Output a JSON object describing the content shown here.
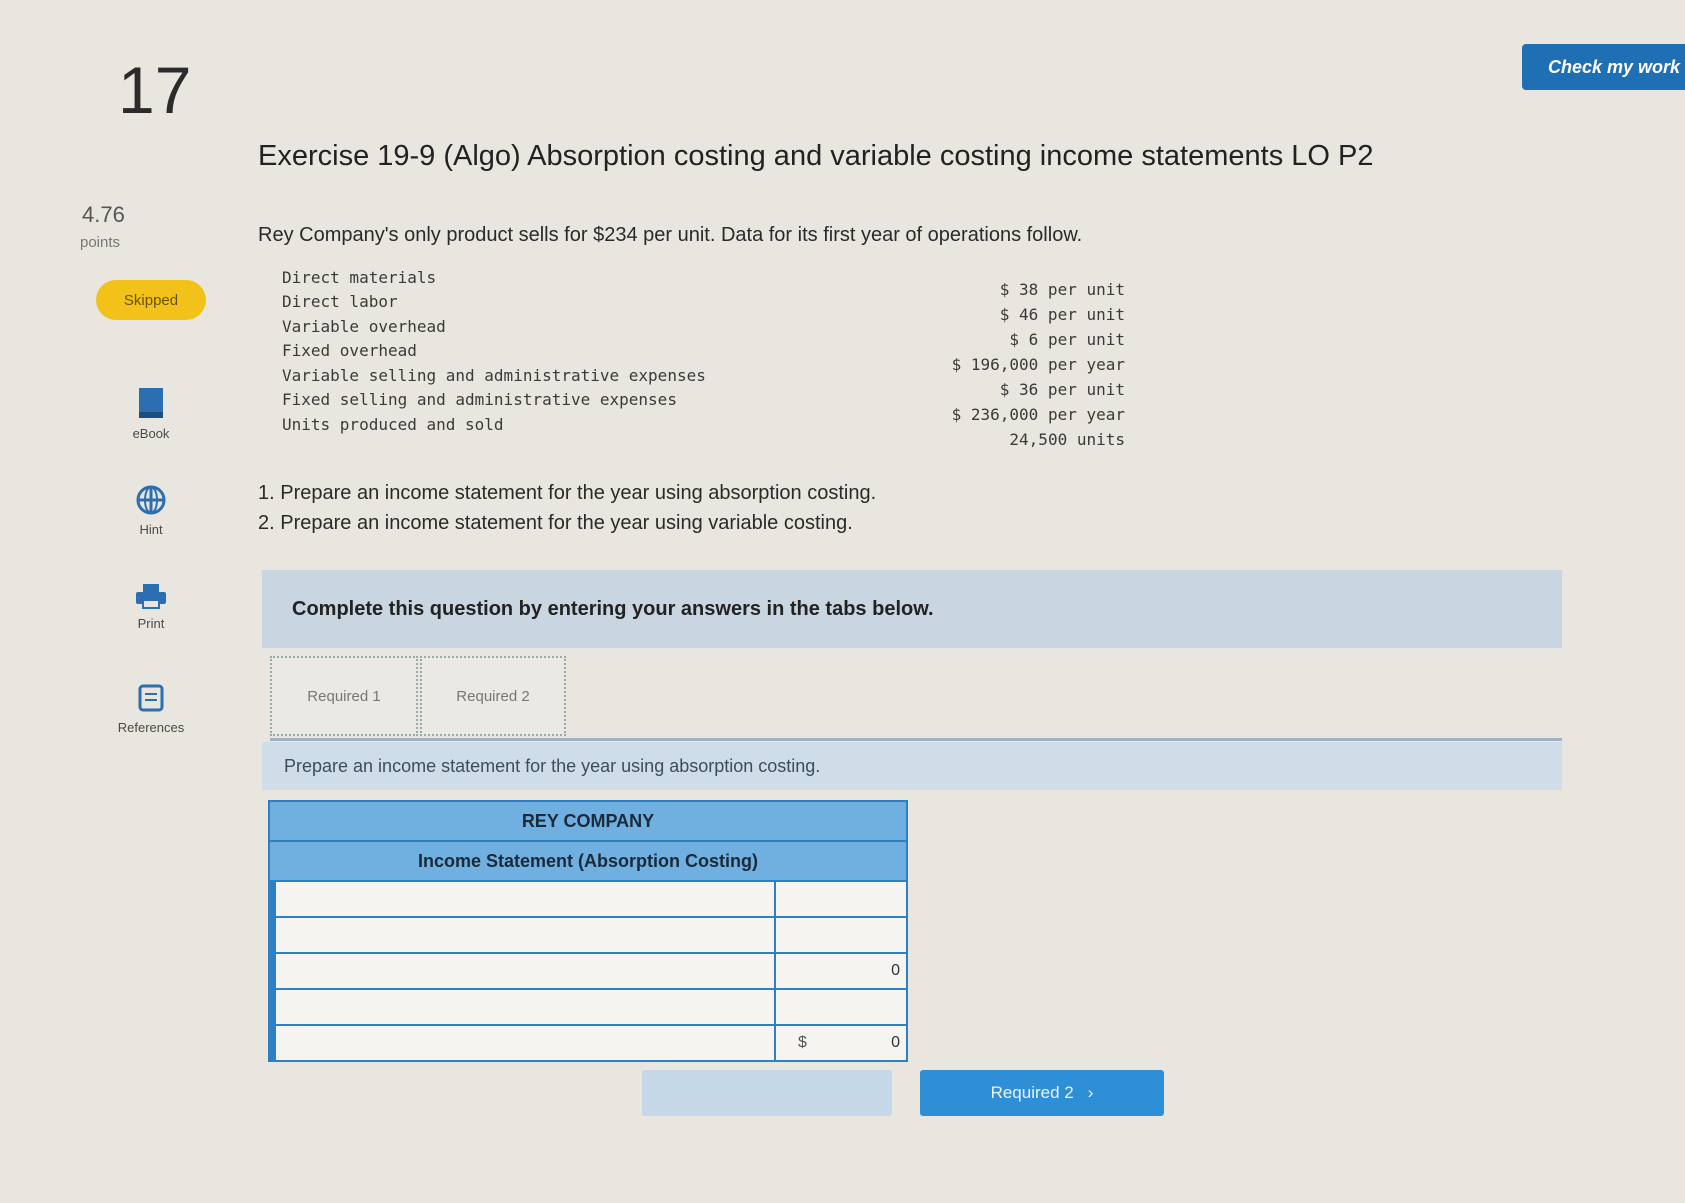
{
  "question": {
    "number": "17",
    "points_value": "4.76",
    "points_label": "points",
    "status": "Skipped"
  },
  "sidebar": {
    "ebook": "eBook",
    "hint": "Hint",
    "print": "Print",
    "references": "References"
  },
  "header": {
    "check_button": "Check my work"
  },
  "exercise": {
    "title": "Exercise 19-9 (Algo) Absorption costing and variable costing income statements LO P2",
    "intro": "Rey Company's only product sells for $234 per unit. Data for its first year of operations follow.",
    "data_rows": [
      {
        "label": "Direct materials",
        "value": "$ 38 per unit"
      },
      {
        "label": "Direct labor",
        "value": "$ 46 per unit"
      },
      {
        "label": "Variable overhead",
        "value": "$ 6 per unit"
      },
      {
        "label": "Fixed overhead",
        "value": "$ 196,000 per year"
      },
      {
        "label": "Variable selling and administrative expenses",
        "value": "$ 36 per unit"
      },
      {
        "label": "Fixed selling and administrative expenses",
        "value": "$ 236,000 per year"
      },
      {
        "label": "Units produced and sold",
        "value": "24,500 units"
      }
    ],
    "instructions": [
      "1. Prepare an income statement for the year using absorption costing.",
      "2. Prepare an income statement for the year using variable costing."
    ],
    "complete_banner": "Complete this question by entering your answers in the tabs below."
  },
  "tabs": [
    {
      "label": "Required 1"
    },
    {
      "label": "Required 2"
    }
  ],
  "panel": {
    "prompt": "Prepare an income statement for the year using absorption costing.",
    "statement": {
      "company": "REY COMPANY",
      "title": "Income Statement (Absorption Costing)",
      "rows": [
        {
          "label": "",
          "currency": "",
          "amount": ""
        },
        {
          "label": "",
          "currency": "",
          "amount": ""
        },
        {
          "label": "",
          "currency": "",
          "amount": "0"
        },
        {
          "label": "",
          "currency": "",
          "amount": ""
        },
        {
          "label": "",
          "currency": "$",
          "amount": "0"
        }
      ]
    }
  },
  "nav": {
    "prev_label": "",
    "next_label": "Required 2",
    "next_arrow": "›"
  },
  "colors": {
    "accent": "#2f8fd6",
    "badge": "#f2c21a",
    "table_header": "#6fb0e0"
  }
}
